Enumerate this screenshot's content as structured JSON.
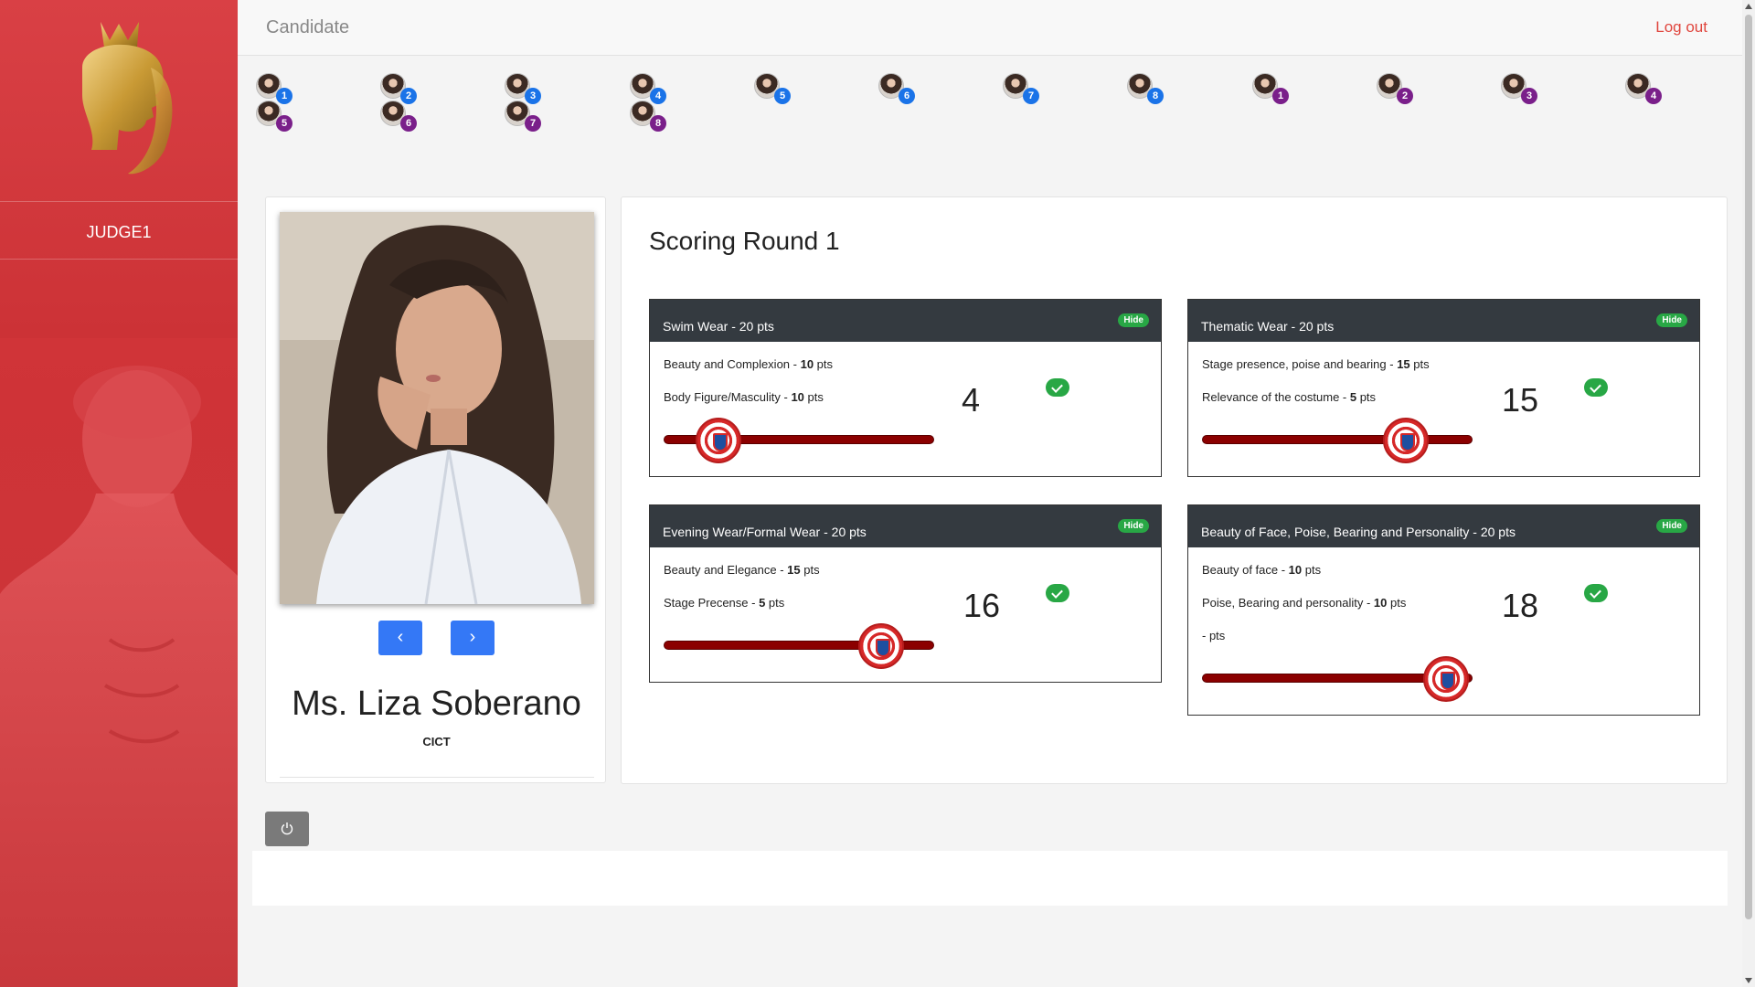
{
  "sidebar": {
    "judge_label": "JUDGE1"
  },
  "header": {
    "title": "Candidate",
    "logout": "Log out"
  },
  "candidates_blue": [
    "1",
    "2",
    "3",
    "4",
    "5",
    "6",
    "7",
    "8"
  ],
  "candidates_purple": [
    "1",
    "2",
    "3",
    "4",
    "5",
    "6",
    "7",
    "8"
  ],
  "candidate": {
    "name": "Ms. Liza Soberano",
    "department": "CICT",
    "prev_icon": "‹",
    "next_icon": "›"
  },
  "scoring": {
    "title": "Scoring Round 1",
    "hide_label": "Hide",
    "criteria": [
      {
        "title": "Swim Wear - 20 pts",
        "lines": [
          {
            "text": "Beauty and Complexion - ",
            "pts": "10",
            "unit": " pts"
          },
          {
            "text": "Body Figure/Masculity - ",
            "pts": "10",
            "unit": " pts"
          }
        ],
        "score": "4",
        "slider_fraction": 0.2
      },
      {
        "title": "Thematic Wear - 20 pts",
        "lines": [
          {
            "text": "Stage presence, poise and bearing - ",
            "pts": "15",
            "unit": " pts"
          },
          {
            "text": "Relevance of the costume - ",
            "pts": "5",
            "unit": " pts"
          }
        ],
        "score": "15",
        "slider_fraction": 0.75
      },
      {
        "title": "Evening Wear/Formal Wear - 20 pts",
        "lines": [
          {
            "text": "Beauty and Elegance - ",
            "pts": "15",
            "unit": " pts"
          },
          {
            "text": "Stage Precense - ",
            "pts": "5",
            "unit": " pts"
          }
        ],
        "score": "16",
        "slider_fraction": 0.8
      },
      {
        "title": "Beauty of Face, Poise, Bearing and Personality - 20 pts",
        "lines": [
          {
            "text": "Beauty of face - ",
            "pts": "10",
            "unit": " pts"
          },
          {
            "text": "Poise, Bearing and personality - ",
            "pts": "10",
            "unit": " pts"
          },
          {
            "text": "- pts",
            "pts": "",
            "unit": ""
          }
        ],
        "score": "18",
        "slider_fraction": 0.9
      }
    ]
  },
  "icons": {
    "power": "power-icon",
    "check": "check-icon"
  },
  "colors": {
    "sidebar": "#d63a3e",
    "header_dark": "#343a40",
    "hide_badge": "#28a745",
    "nav_button": "#3478f6",
    "badge_blue": "#1a73e8",
    "badge_purple": "#7a1f8a",
    "slider": "#8b0000"
  }
}
